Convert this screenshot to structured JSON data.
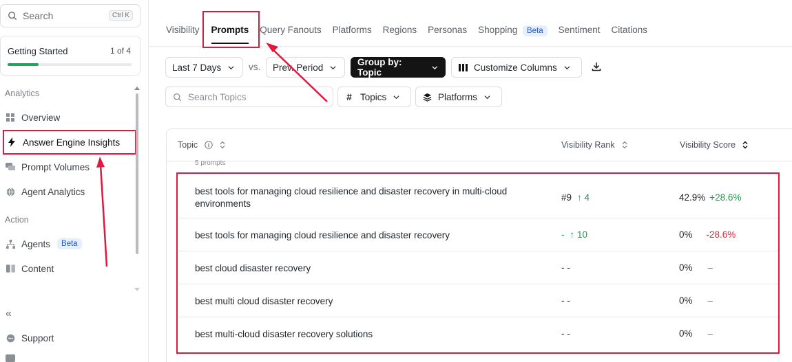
{
  "sidebar": {
    "search": {
      "placeholder": "Search",
      "shortcut": "Ctrl K"
    },
    "getting_started": {
      "title": "Getting Started",
      "count": "1 of 4",
      "progress": 0.25
    },
    "sections": {
      "analytics": "Analytics",
      "action": "Action"
    },
    "items": [
      {
        "label": "Overview",
        "icon": "grid-icon"
      },
      {
        "label": "Answer Engine Insights",
        "icon": "bolt-icon"
      },
      {
        "label": "Prompt Volumes",
        "icon": "chat-icon"
      },
      {
        "label": "Agent Analytics",
        "icon": "globe-icon"
      },
      {
        "label": "Agents",
        "icon": "hierarchy-icon",
        "badge": "Beta"
      },
      {
        "label": "Content",
        "icon": "book-icon"
      }
    ],
    "support": "Support"
  },
  "tabs": [
    {
      "label": "Visibility"
    },
    {
      "label": "Prompts",
      "active": true
    },
    {
      "label": "Query Fanouts"
    },
    {
      "label": "Platforms"
    },
    {
      "label": "Regions"
    },
    {
      "label": "Personas"
    },
    {
      "label": "Shopping",
      "badge": "Beta"
    },
    {
      "label": "Sentiment"
    },
    {
      "label": "Citations"
    }
  ],
  "filters": {
    "period": "Last 7 Days",
    "vs": "vs.",
    "compare": "Prev. Period",
    "group_by": "Group by: Topic",
    "customize": "Customize Columns",
    "search_placeholder": "Search Topics",
    "topics": "Topics",
    "platforms": "Platforms"
  },
  "table": {
    "headers": {
      "topic": "Topic",
      "rank": "Visibility Rank",
      "score": "Visibility Score"
    },
    "prompt_count": "5 prompts",
    "rows": [
      {
        "topic": "best tools for managing cloud resilience and disaster recovery in multi-cloud environments",
        "rank": "#9",
        "rank_change": "↑ 4",
        "score": "42.9%",
        "score_change": "+28.6%"
      },
      {
        "topic": "best tools for managing cloud resilience and disaster recovery",
        "rank": "-",
        "rank_change": "↑ 10",
        "score": "0%",
        "score_change": "-28.6%"
      },
      {
        "topic": "best cloud disaster recovery",
        "rank": "- -",
        "rank_change": "",
        "score": "0%",
        "score_change": "–"
      },
      {
        "topic": "best multi cloud disaster recovery",
        "rank": "- -",
        "rank_change": "",
        "score": "0%",
        "score_change": "–"
      },
      {
        "topic": "best multi-cloud disaster recovery solutions",
        "rank": "- -",
        "rank_change": "",
        "score": "0%",
        "score_change": "–"
      }
    ]
  },
  "colors": {
    "highlight": "#e3173e",
    "positive": "#1b9a4c",
    "negative": "#d9283e",
    "progress": "#22a45d"
  }
}
